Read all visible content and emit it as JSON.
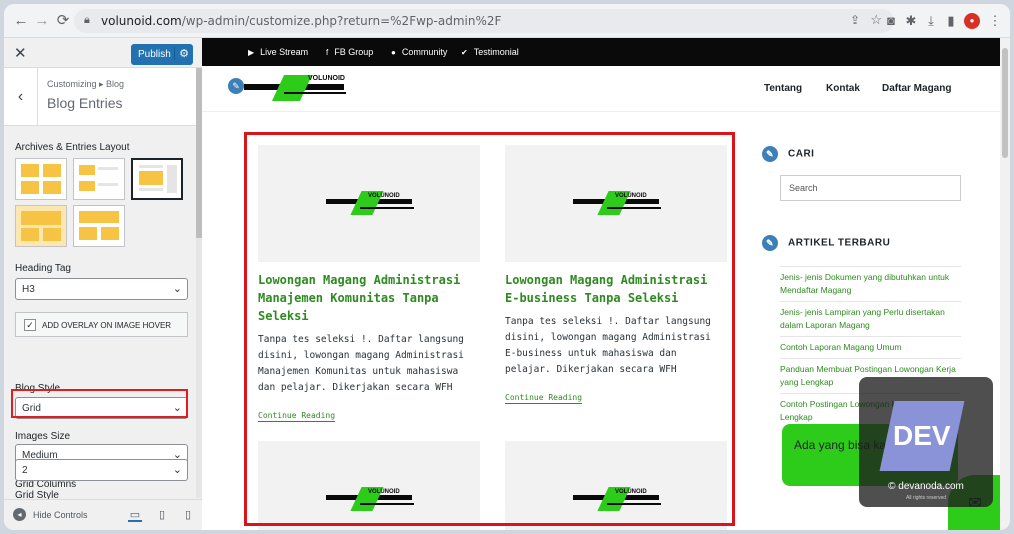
{
  "browser": {
    "url_host": "volunoid.com",
    "url_path": "/wp-admin/customize.php?return=%2Fwp-admin%2F",
    "back": "←",
    "forward": "→",
    "reload": "⟳"
  },
  "customizer": {
    "publish_label": "Publish",
    "breadcrumb": "Customizing ▸ Blog",
    "section_title": "Blog Entries",
    "layout_label": "Archives & Entries Layout",
    "heading_tag_label": "Heading Tag",
    "heading_tag_value": "H3",
    "overlay_label": "ADD OVERLAY ON IMAGE HOVER",
    "overlay_checked": true,
    "blog_style_label": "Blog Style",
    "blog_style_value": "Grid",
    "images_size_label": "Images Size",
    "images_size_value": "Medium",
    "grid_columns_label": "Grid Columns",
    "grid_columns_value": "2",
    "grid_style_label": "Grid Style",
    "hide_controls": "Hide Controls"
  },
  "site": {
    "topbar": [
      {
        "icon": "youtube-icon",
        "glyph": "▶",
        "label": "Live Stream"
      },
      {
        "icon": "facebook-icon",
        "glyph": "f",
        "label": "FB Group"
      },
      {
        "icon": "community-icon",
        "glyph": "●",
        "label": "Community"
      },
      {
        "icon": "testimonial-icon",
        "glyph": "✔",
        "label": "Testimonial"
      }
    ],
    "logo_text": "VOLUNOID",
    "nav": [
      "Tentang",
      "Kontak",
      "Daftar Magang"
    ],
    "cards": [
      {
        "title": "Lowongan Magang Administrasi Manajemen Komunitas Tanpa Seleksi",
        "excerpt": "Tanpa tes seleksi !. Daftar langsung disini, lowongan magang Administrasi Manajemen Komunitas untuk mahasiswa dan pelajar. Dikerjakan secara WFH",
        "more": "Continue Reading"
      },
      {
        "title": "Lowongan Magang Administrasi E-business Tanpa Seleksi",
        "excerpt": "Tanpa tes seleksi !. Daftar langsung disini, lowongan magang Administrasi E-business untuk mahasiswa dan pelajar. Dikerjakan secara WFH",
        "more": "Continue Reading"
      }
    ],
    "search_heading": "CARI",
    "search_placeholder": "Search",
    "recent_heading": "ARTIKEL TERBARU",
    "recent_posts": [
      "Jenis- jenis Dokumen yang dibutuhkan untuk Mendaftar Magang",
      "Jenis- jenis Lampiran yang Perlu disertakan dalam Laporan Magang",
      "Contoh Laporan Magang Umum",
      "Panduan Membuat Postingan Lowongan Kerja yang Lengkap",
      "Contoh Postingan Lowongan Kerja yang Super Lengkap"
    ],
    "chat_text": "Ada yang bisa kami bantu?"
  },
  "watermark": {
    "logo": "DEV",
    "site": "© devanoda.com",
    "small": "All rights reserved"
  },
  "colors": {
    "accent_green": "#2ecc1a",
    "title_green": "#2e8b20",
    "highlight_red": "#d9141b",
    "wp_blue": "#2271b1"
  }
}
